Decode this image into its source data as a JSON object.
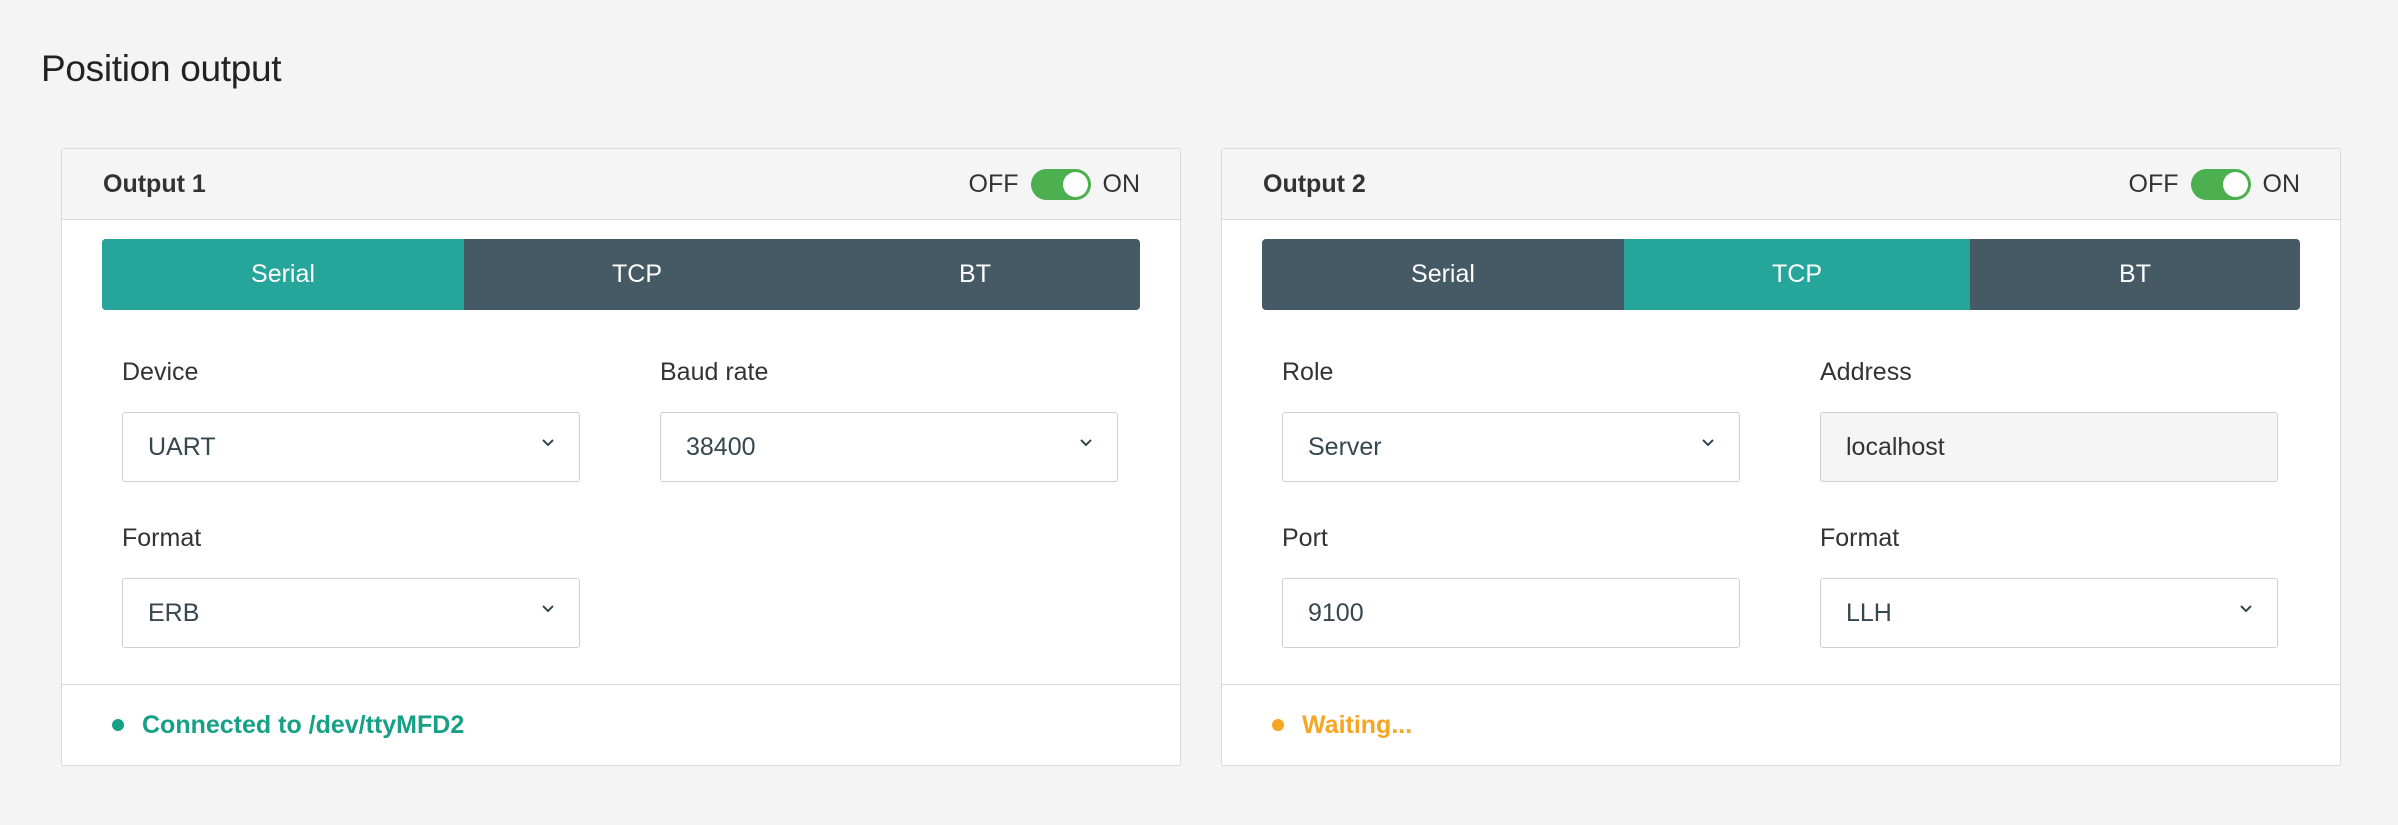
{
  "page": {
    "title": "Position output"
  },
  "colors": {
    "accent": "#26a69a",
    "tab_bg": "#455a64",
    "toggle_on": "#4caf50",
    "connected": "#16a085",
    "waiting": "#f5a623"
  },
  "outputs": [
    {
      "title": "Output 1",
      "toggle": {
        "off_label": "OFF",
        "on_label": "ON",
        "state": "on"
      },
      "tabs": [
        "Serial",
        "TCP",
        "BT"
      ],
      "active_tab": "Serial",
      "fields": {
        "device": {
          "label": "Device",
          "value": "UART",
          "icon": "chevron-down-icon"
        },
        "baud_rate": {
          "label": "Baud rate",
          "value": "38400",
          "icon": "chevron-down-icon"
        },
        "format": {
          "label": "Format",
          "value": "ERB",
          "icon": "chevron-down-icon"
        }
      },
      "status": {
        "text": "Connected to /dev/ttyMFD2",
        "color": "#16a085"
      }
    },
    {
      "title": "Output 2",
      "toggle": {
        "off_label": "OFF",
        "on_label": "ON",
        "state": "on"
      },
      "tabs": [
        "Serial",
        "TCP",
        "BT"
      ],
      "active_tab": "TCP",
      "fields": {
        "role": {
          "label": "Role",
          "value": "Server",
          "icon": "chevron-down-icon"
        },
        "address": {
          "label": "Address",
          "value": "localhost"
        },
        "port": {
          "label": "Port",
          "value": "9100"
        },
        "format": {
          "label": "Format",
          "value": "LLH",
          "icon": "chevron-down-icon"
        }
      },
      "status": {
        "text": "Waiting...",
        "color": "#f5a623"
      }
    }
  ]
}
